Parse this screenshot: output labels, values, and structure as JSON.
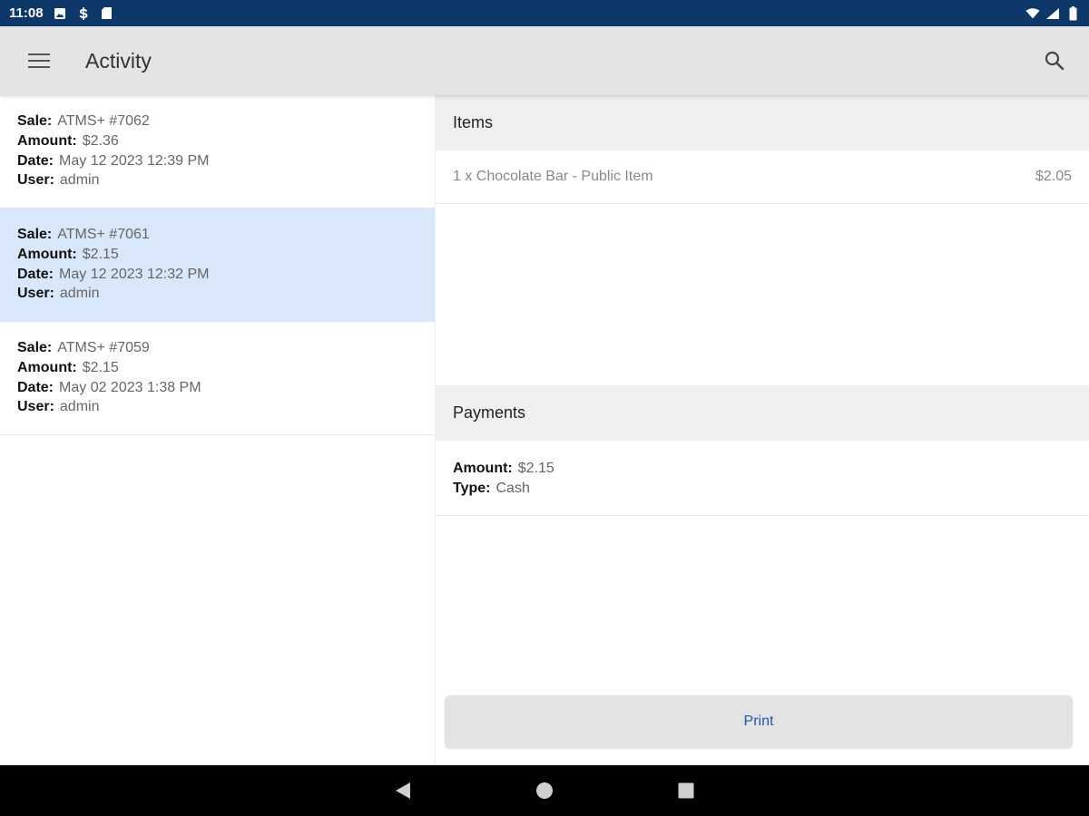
{
  "status_bar": {
    "time": "11:08",
    "icons": [
      "image-notification-icon",
      "s-notification-icon",
      "sd-card-icon",
      "wifi-icon",
      "signal-icon",
      "battery-icon"
    ]
  },
  "app_bar": {
    "title": "Activity",
    "menu_icon": "menu-icon",
    "search_icon": "search-icon"
  },
  "sales": [
    {
      "sale_label": "Sale:",
      "sale": "ATMS+ #7062",
      "amount_label": "Amount:",
      "amount": "$2.36",
      "date_label": "Date:",
      "date": "May 12 2023 12:39 PM",
      "user_label": "User:",
      "user": "admin",
      "selected": false
    },
    {
      "sale_label": "Sale:",
      "sale": "ATMS+ #7061",
      "amount_label": "Amount:",
      "amount": "$2.15",
      "date_label": "Date:",
      "date": "May 12 2023 12:32 PM",
      "user_label": "User:",
      "user": "admin",
      "selected": true
    },
    {
      "sale_label": "Sale:",
      "sale": "ATMS+ #7059",
      "amount_label": "Amount:",
      "amount": "$2.15",
      "date_label": "Date:",
      "date": "May 02 2023 1:38 PM",
      "user_label": "User:",
      "user": "admin",
      "selected": false
    }
  ],
  "items_section": {
    "header": "Items",
    "items": [
      {
        "description": "1 x Chocolate Bar  - Public Item",
        "price": "$2.05"
      }
    ]
  },
  "payments_section": {
    "header": "Payments",
    "amount_label": "Amount:",
    "amount": "$2.15",
    "type_label": "Type:",
    "type": "Cash"
  },
  "print_button": {
    "label": "Print"
  },
  "nav_bar": {
    "icons": [
      "back-icon",
      "home-icon",
      "recents-icon"
    ]
  },
  "colors": {
    "status_bar": "#0d3869",
    "app_bar": "#e4e4e4",
    "selected_row": "#d8e7f9",
    "print_text": "#1f5aa8"
  }
}
